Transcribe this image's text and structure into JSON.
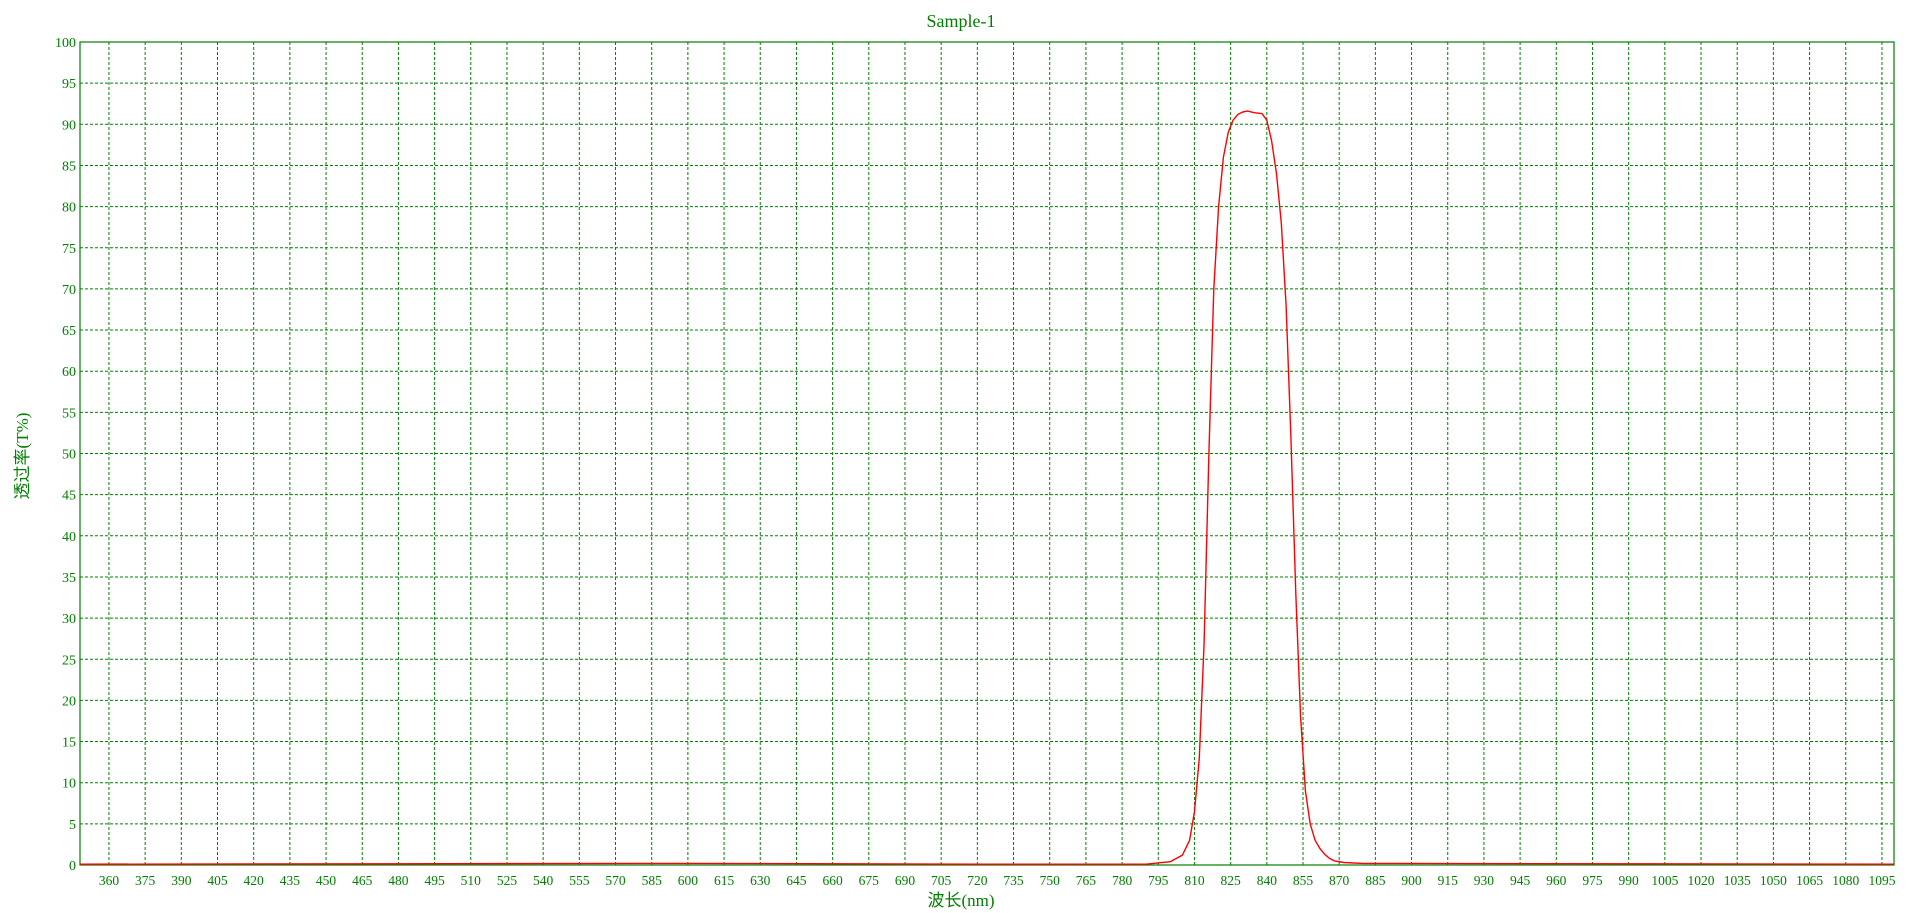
{
  "chart_data": {
    "type": "line",
    "title": "Sample-1",
    "xlabel": "波长(nm)",
    "ylabel": "透过率(T%)",
    "xlim": [
      348,
      1100
    ],
    "ylim": [
      0,
      100
    ],
    "x_ticks": [
      360,
      375,
      390,
      405,
      420,
      435,
      450,
      465,
      480,
      495,
      510,
      525,
      540,
      555,
      570,
      585,
      600,
      615,
      630,
      645,
      660,
      675,
      690,
      705,
      720,
      735,
      750,
      765,
      780,
      795,
      810,
      825,
      840,
      855,
      870,
      885,
      900,
      915,
      930,
      945,
      960,
      975,
      990,
      1005,
      1020,
      1035,
      1050,
      1065,
      1080,
      1095
    ],
    "y_ticks": [
      0,
      5,
      10,
      15,
      20,
      25,
      30,
      35,
      40,
      45,
      50,
      55,
      60,
      65,
      70,
      75,
      80,
      85,
      90,
      95,
      100
    ],
    "grid": true,
    "legend": "none",
    "colors": {
      "axis": "#008000",
      "grid": "#008000",
      "series": "#ff0000"
    },
    "series": [
      {
        "x": [
          348,
          600,
          720,
          790,
          800,
          805,
          808,
          810,
          812,
          814,
          816,
          818,
          820,
          822,
          824,
          826,
          828,
          830,
          832,
          835,
          838,
          840,
          842,
          844,
          846,
          848,
          850,
          852,
          854,
          856,
          858,
          860,
          862,
          864,
          866,
          868,
          872,
          880,
          1100
        ],
        "y": [
          0.1,
          0.2,
          0.1,
          0.1,
          0.4,
          1.2,
          3.0,
          6.5,
          13,
          27,
          50,
          70,
          80,
          86,
          89,
          90.5,
          91.2,
          91.5,
          91.6,
          91.4,
          91.3,
          90.5,
          88,
          84,
          78,
          68,
          52,
          33,
          18,
          9,
          5,
          3,
          2,
          1.3,
          0.8,
          0.5,
          0.3,
          0.2,
          0.1
        ]
      }
    ]
  }
}
